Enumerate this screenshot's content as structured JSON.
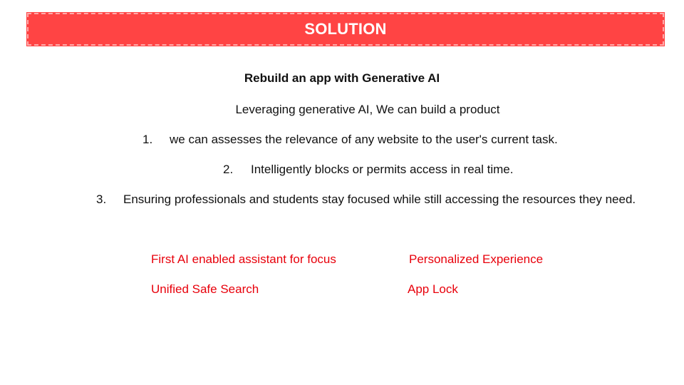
{
  "slide": {
    "title": "SOLUTION",
    "heading": "Rebuild an app with Generative AI",
    "intro": "Leveraging generative AI, We can build a product",
    "list": [
      {
        "number": "1.",
        "text": "we can assesses the relevance of any website to the user's current task."
      },
      {
        "number": "2.",
        "text": "Intelligently blocks or permits access in real time."
      },
      {
        "number": "3.",
        "text": "Ensuring professionals and students stay focused while still accessing the resources they need."
      }
    ],
    "features": [
      "First AI enabled assistant for focus",
      "Personalized Experience",
      "Unified Safe Search",
      "App Lock"
    ]
  },
  "colors": {
    "banner": "#ff4444",
    "title_text": "#ffffff",
    "feature_text": "#e8000b",
    "body_text": "#111111"
  }
}
